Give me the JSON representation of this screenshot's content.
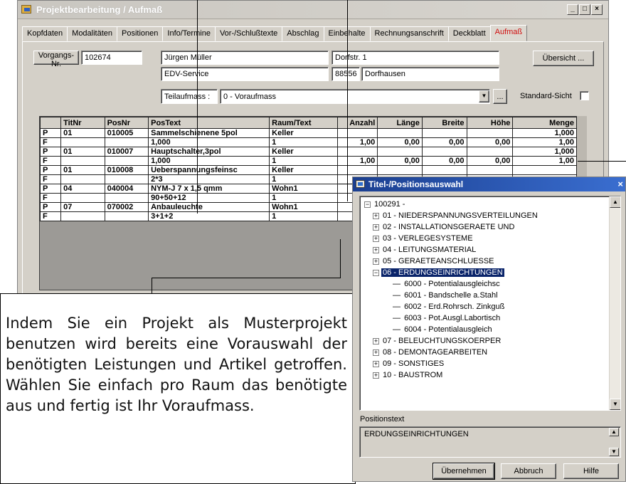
{
  "window": {
    "title": "Projektbearbeitung / Aufmaß",
    "caption_buttons": {
      "minimize": "_",
      "maximize": "□",
      "close": "×"
    }
  },
  "tabs": [
    {
      "label": "Kopfdaten"
    },
    {
      "label": "Modalitäten"
    },
    {
      "label": "Positionen"
    },
    {
      "label": "Info/Termine"
    },
    {
      "label": "Vor-/Schlußtexte"
    },
    {
      "label": "Abschlag"
    },
    {
      "label": "Einbehalte"
    },
    {
      "label": "Rechnungsanschrift"
    },
    {
      "label": "Deckblatt"
    },
    {
      "label": "Aufmaß"
    }
  ],
  "header": {
    "vorgang_button": "Vorgangs-Nr.",
    "vorgang_nr": "102674",
    "name": "Jürgen Müller",
    "company": "EDV-Service",
    "street": "Dorfstr. 1",
    "zip": "88556",
    "city": "Dorfhausen",
    "uebersicht_button": "Übersicht ...",
    "teilaufmass_label": "Teilaufmass :",
    "teilaufmass_value": "0 - Voraufmass",
    "dropdown_arrow": "▼",
    "ellipsis_button": "...",
    "standard_sicht_label": "Standard-Sicht"
  },
  "grid": {
    "columns": [
      "",
      "TitNr",
      "PosNr",
      "PosText",
      "Raum/Text",
      "Anzahl",
      "Länge",
      "Breite",
      "Höhe",
      "Menge"
    ],
    "rows": [
      [
        "P",
        "01",
        "010005",
        "Sammelschienene 5pol",
        "Keller",
        "",
        "",
        "",
        "",
        "1,000"
      ],
      [
        "F",
        "",
        "",
        "1,000",
        "1",
        "1,00",
        "0,00",
        "0,00",
        "0,00",
        "1,00"
      ],
      [
        "P",
        "01",
        "010007",
        "Hauptschalter,3pol",
        "Keller",
        "",
        "",
        "",
        "",
        "1,000"
      ],
      [
        "F",
        "",
        "",
        "1,000",
        "1",
        "1,00",
        "0,00",
        "0,00",
        "0,00",
        "1,00"
      ],
      [
        "P",
        "01",
        "010008",
        "Ueberspannungsfeinsc",
        "Keller",
        "",
        "",
        "",
        "",
        ""
      ],
      [
        "F",
        "",
        "",
        "2*3",
        "1",
        "",
        "",
        "",
        "",
        ""
      ],
      [
        "P",
        "04",
        "040004",
        "NYM-J 7 x 1,5 qmm",
        "Wohn1",
        "",
        "",
        "",
        "",
        ""
      ],
      [
        "F",
        "",
        "",
        "90+50+12",
        "1",
        "",
        "",
        "",
        "",
        ""
      ],
      [
        "P",
        "07",
        "070002",
        "Anbauleuchte",
        "Wohn1",
        "",
        "",
        "",
        "",
        ""
      ],
      [
        "F",
        "",
        "",
        "3+1+2",
        "1",
        "",
        "",
        "",
        "",
        ""
      ]
    ]
  },
  "callout": {
    "text": "Indem Sie ein Projekt als Musterprojekt benutzen wird bereits eine Vorauswahl der benötigten Leistungen und Artikel getroffen. Wählen Sie einfach pro Raum das benötigte aus und fertig ist Ihr Voraufmass."
  },
  "popup": {
    "title": "Titel-/Positionsauswahl",
    "close": "×",
    "tree_root": "100291 -",
    "tree_items": [
      {
        "label": "01 - NIEDERSPANNUNGSVERTEILUNGEN"
      },
      {
        "label": "02 - INSTALLATIONSGERAETE UND"
      },
      {
        "label": "03 - VERLEGESYSTEME"
      },
      {
        "label": "04 - LEITUNGSMATERIAL"
      },
      {
        "label": "05 - GERAETEANSCHLUESSE"
      },
      {
        "label": "06 - ERDUNGSEINRICHTUNGEN",
        "expanded": true,
        "selected": true
      },
      {
        "label": "07 - BELEUCHTUNGSKOERPER"
      },
      {
        "label": "08 - DEMONTAGEARBEITEN"
      },
      {
        "label": "09 - SONSTIGES"
      },
      {
        "label": "10 - BAUSTROM"
      }
    ],
    "tree_children": [
      {
        "label": "6000 - Potentialausgleichsc"
      },
      {
        "label": "6001 - Bandschelle a.Stahl"
      },
      {
        "label": "6002 - Erd.Rohrsch. Zinkguß"
      },
      {
        "label": "6003 - Pot.Ausgl.Labortisch"
      },
      {
        "label": "6004 - Potentialausgleich"
      }
    ],
    "positionstext_label": "Positionstext",
    "positionstext_value": "ERDUNGSEINRICHTUNGEN",
    "buttons": {
      "ok": "Übernehmen",
      "cancel": "Abbruch",
      "help": "Hilfe"
    }
  }
}
